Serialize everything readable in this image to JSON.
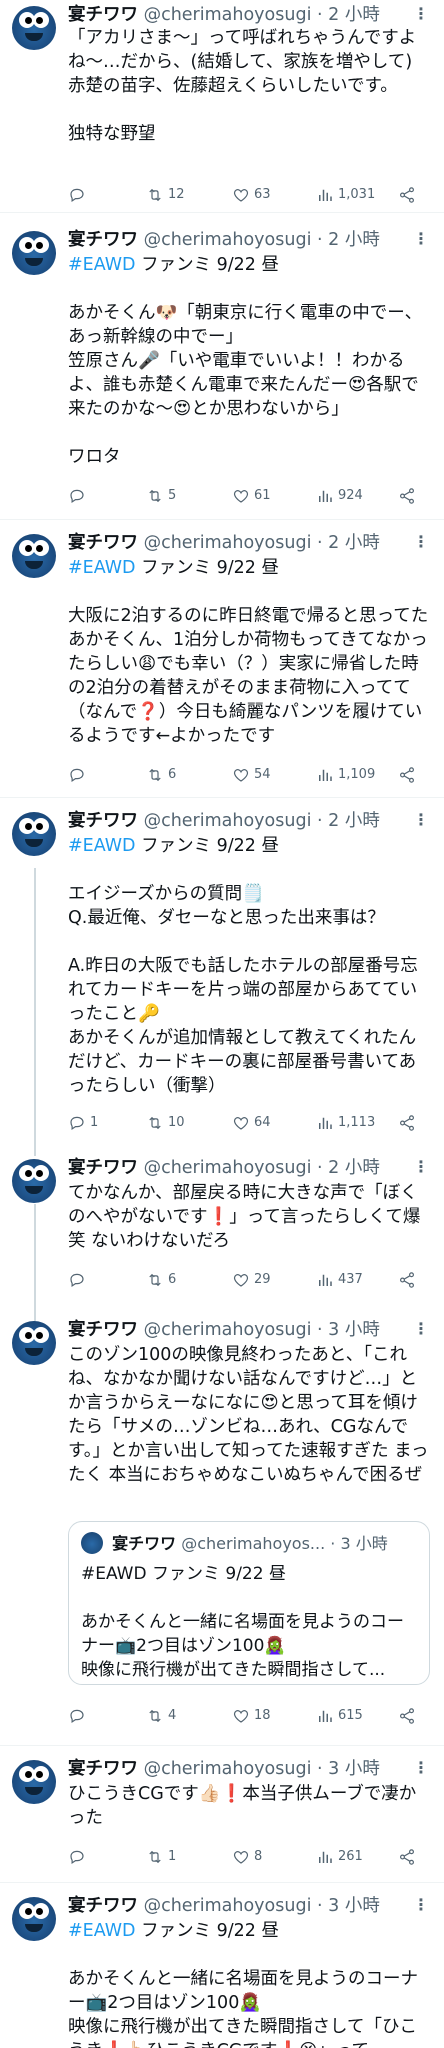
{
  "colors": {
    "accent": "#1d9bf0",
    "text": "#0f1419",
    "muted": "#536471",
    "divider": "#eff3f4"
  },
  "icons": {
    "reply": "reply-icon",
    "retweet": "retweet-icon",
    "like": "heart-icon",
    "views": "views-icon",
    "share": "share-icon",
    "more": "more-icon"
  },
  "tweets": [
    {
      "name": "",
      "handle": "",
      "time": "",
      "hashtag": "",
      "hashtag_suffix": "",
      "text": "「アカリさま〜」って呼ばれちゃうんですよね〜…だから、(結婚して、家族を増やして) 赤楚の苗字、佐藤超えくらいしたいです。\n\n独特な野望",
      "replies": "",
      "retweets": "12",
      "likes": "63",
      "views": "1,031"
    },
    {
      "name": "宴チワワ",
      "handle": "@cherimahoyosugi",
      "time": "· 2 小時",
      "hashtag": "#EAWD",
      "hashtag_suffix": " ファンミ 9/22 昼",
      "text": "あかそくん🐶「朝東京に行く電車の中でー、あっ新幹線の中でー」\n笠原さん🎤「いや電車でいいよ！！わかるよ、誰も赤楚くん電車で来たんだー😍各駅で来たのかな〜😍とか思わないから」\n\nワロタ",
      "replies": "",
      "retweets": "5",
      "likes": "61",
      "views": "924"
    },
    {
      "name": "宴チワワ",
      "handle": "@cherimahoyosugi",
      "time": "· 2 小時",
      "hashtag": "#EAWD",
      "hashtag_suffix": " ファンミ 9/22 昼",
      "text": "大阪に2泊するのに昨日終電で帰ると思ってたあかそくん、1泊分しか荷物もってきてなかったらしい😩でも幸い（？）実家に帰省した時の2泊分の着替えがそのまま荷物に入ってて（なんで❓）今日も綺麗なパンツを履けているようです←よかったです",
      "replies": "",
      "retweets": "6",
      "likes": "54",
      "views": "1,109"
    },
    {
      "name": "宴チワワ",
      "handle": "@cherimahoyosugi",
      "time": "· 2 小時",
      "hashtag": "#EAWD",
      "hashtag_suffix": " ファンミ 9/22 昼",
      "text": "エイジーズからの質問🗒️\nQ.最近俺、ダセーなと思った出来事は？\n\nA.昨日の大阪でも話したホテルの部屋番号忘れてカードキーを片っ端の部屋からあてていったこと🔑\nあかそくんが追加情報として教えてくれたんだけど、カードキーの裏に部屋番号書いてあったらしい（衝撃）",
      "replies": "1",
      "retweets": "10",
      "likes": "64",
      "views": "1,113"
    },
    {
      "name": "宴チワワ",
      "handle": "@cherimahoyosugi",
      "time": "· 2 小時",
      "hashtag": "",
      "hashtag_suffix": "",
      "text": "てかなんか、部屋戻る時に大きな声で「ぼくのへやがないです❗」って言ったらしくて爆笑 ないわけないだろ",
      "replies": "",
      "retweets": "6",
      "likes": "29",
      "views": "437"
    },
    {
      "name": "宴チワワ",
      "handle": "@cherimahoyosugi",
      "time": "· 3 小時",
      "hashtag": "",
      "hashtag_suffix": "",
      "text": "このゾン100の映像見終わったあと、「これね、なかなか聞けない話なんですけど…」とか言うからえーなになに😍と思って耳を傾けたら「サメの…ゾンビね…あれ、CGなんです。」とか言い出して知ってた速報すぎた まったく 本当におちゃめなこいぬちゃんで困るぜ",
      "replies": "",
      "retweets": "4",
      "likes": "18",
      "views": "615",
      "quote": {
        "name": "宴チワワ",
        "handle": "@cherimahoyos...",
        "time": "· 3 小時",
        "text": "#EAWD ファンミ 9/22 昼\n\nあかそくんと一緒に名場面を見ようのコーナー📺2つ目はゾン100🧟‍♀️\n映像に飛行機が出てきた瞬間指さして..."
      }
    },
    {
      "name": "宴チワワ",
      "handle": "@cherimahoyosugi",
      "time": "· 3 小時",
      "hashtag": "",
      "hashtag_suffix": "",
      "text": "ひこうきCGです👍🏻❗本当子供ムーブで凄かった",
      "replies": "",
      "retweets": "1",
      "likes": "8",
      "views": "261"
    },
    {
      "name": "宴チワワ",
      "handle": "@cherimahoyosugi",
      "time": "· 3 小時",
      "hashtag": "#EAWD",
      "hashtag_suffix": " ファンミ 9/22 昼",
      "text": "あかそくんと一緒に名場面を見ようのコーナー📺2つ目はゾン100🧟‍♀️\n映像に飛行機が出てきた瞬間指さして「ひこうき❗👆🏻ひこうきCGです❗😆」って"
    }
  ]
}
